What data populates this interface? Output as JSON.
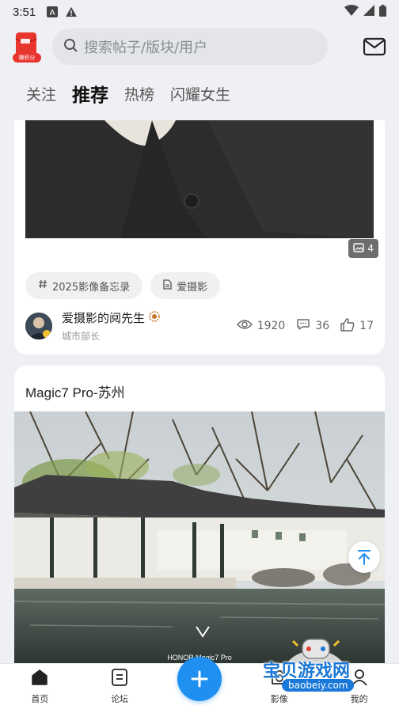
{
  "status_bar": {
    "time": "3:51"
  },
  "header": {
    "redpacket_label": "赚积分",
    "search_placeholder": "搜索帖子/版块/用户"
  },
  "tabs": [
    {
      "label": "关注",
      "active": false
    },
    {
      "label": "推荐",
      "active": true
    },
    {
      "label": "热榜",
      "active": false
    },
    {
      "label": "闪耀女生",
      "active": false
    }
  ],
  "post1": {
    "image_count": "4",
    "chips": [
      "2025影像备忘录",
      "爱摄影"
    ],
    "author_name": "爱摄影的阋先生",
    "author_title": "城市部长",
    "views": "1920",
    "comments": "36",
    "likes": "17"
  },
  "post2": {
    "title": "Magic7 Pro-苏州",
    "photo_watermark": "HONOR Magic7 Pro"
  },
  "bottom_nav": [
    {
      "label": "首页"
    },
    {
      "label": "论坛"
    },
    {
      "label": "影像"
    },
    {
      "label": "我的"
    }
  ],
  "watermark": {
    "text": "宝贝游戏网",
    "url": "baobeiy.com"
  },
  "colors": {
    "accent": "#1f8ff0",
    "background": "#eef0f3"
  }
}
